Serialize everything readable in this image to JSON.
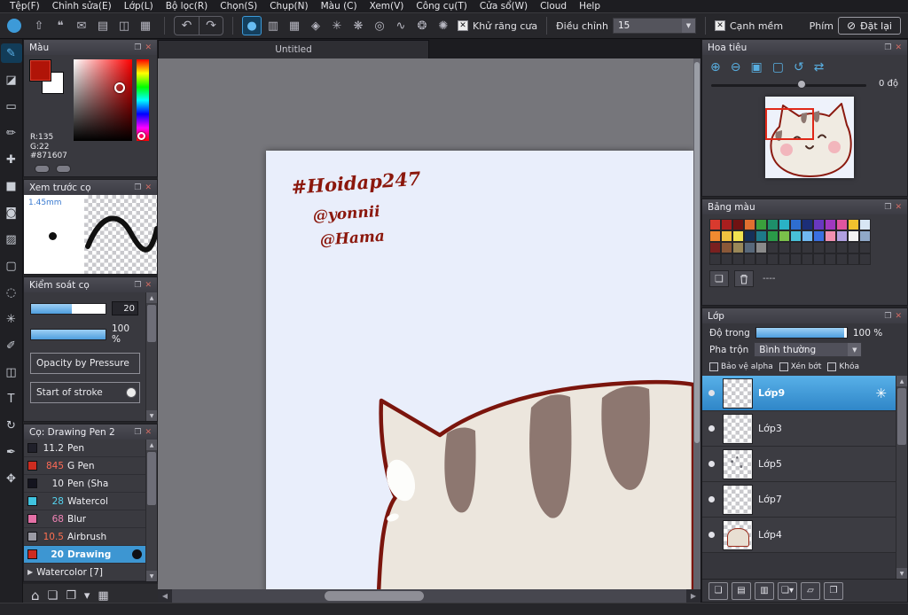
{
  "menubar": {
    "items": [
      "Tệp(F)",
      "Chỉnh sửa(E)",
      "Lớp(L)",
      "Bộ lọc(R)",
      "Chọn(S)",
      "Chụp(N)",
      "Màu (C)",
      "Xem(V)",
      "Công cụ(T)",
      "Cửa sổ(W)",
      "Cloud",
      "Help"
    ]
  },
  "toolbar": {
    "left_icons": [
      {
        "name": "export-icon",
        "glyph": "⇧"
      },
      {
        "name": "comment-icon",
        "glyph": "❝"
      },
      {
        "name": "message-icon",
        "glyph": "✉"
      },
      {
        "name": "document-icon",
        "glyph": "▤"
      },
      {
        "name": "layout-icon",
        "glyph": "◫"
      },
      {
        "name": "grid-icon",
        "glyph": "▦"
      }
    ],
    "undo_icon": "↶",
    "redo_icon": "↷",
    "option_icons": [
      {
        "name": "brush-circle-icon",
        "glyph": "●",
        "active": true
      },
      {
        "name": "brush-gradient-icon",
        "glyph": "▥"
      },
      {
        "name": "halftone-icon",
        "glyph": "▦"
      },
      {
        "name": "pattern-icon",
        "glyph": "◈"
      },
      {
        "name": "scatter-icon",
        "glyph": "✳"
      },
      {
        "name": "snowflake-icon",
        "glyph": "❋"
      },
      {
        "name": "target-icon",
        "glyph": "◎"
      },
      {
        "name": "correction-curve-icon",
        "glyph": "∿"
      },
      {
        "name": "gear-icon",
        "glyph": "❂"
      },
      {
        "name": "settings-icon",
        "glyph": "✺"
      }
    ],
    "antialias_label": "Khử răng cưa",
    "correction_label": "Điều chỉnh",
    "correction_value": "15",
    "soft_edge_label": "Cạnh mềm",
    "key_label": "Phím",
    "reset_button": "Đặt lại"
  },
  "left_tools": [
    {
      "name": "brush-tool",
      "glyph": "✎",
      "active": true
    },
    {
      "name": "eraser-tool",
      "glyph": "◪"
    },
    {
      "name": "rectangle-tool",
      "glyph": "▭"
    },
    {
      "name": "dot-pen-tool",
      "glyph": "✏"
    },
    {
      "name": "move-tool",
      "glyph": "✚"
    },
    {
      "name": "fill-rect-tool",
      "glyph": "■"
    },
    {
      "name": "bucket-tool",
      "glyph": "◙"
    },
    {
      "name": "gradient-tool",
      "glyph": "▨"
    },
    {
      "name": "select-rect-tool",
      "glyph": "▢"
    },
    {
      "name": "lasso-tool",
      "glyph": "◌"
    },
    {
      "name": "magic-wand-tool",
      "glyph": "✳"
    },
    {
      "name": "select-pen-tool",
      "glyph": "✐"
    },
    {
      "name": "select-eraser-tool",
      "glyph": "◫"
    },
    {
      "name": "text-tool",
      "glyph": "T"
    },
    {
      "name": "rotate-view-tool",
      "glyph": "↻"
    },
    {
      "name": "eyedropper-tool",
      "glyph": "✒"
    },
    {
      "name": "pan-tool",
      "glyph": "✥"
    }
  ],
  "left_footer_icons": [
    {
      "name": "home-icon",
      "glyph": "⌂"
    },
    {
      "name": "new-canvas-icon",
      "glyph": "❏"
    },
    {
      "name": "open-canvas-icon",
      "glyph": "❐"
    },
    {
      "name": "canvas-options-icon",
      "glyph": "▾"
    },
    {
      "name": "gallery-icon",
      "glyph": "▦"
    }
  ],
  "color_panel": {
    "title": "Màu",
    "r_value": "R:135",
    "g_value": "G:22",
    "hex_value": "#871607"
  },
  "brush_preview_panel": {
    "title": "Xem trước cọ",
    "size_label": "1.45mm"
  },
  "brush_control_panel": {
    "title": "Kiểm soát cọ",
    "width_value": "20",
    "opacity_value": "100 %",
    "row1_label": "Opacity by Pressure",
    "row2_label": "Start of stroke"
  },
  "brush_list_panel": {
    "title": "Cọ: Drawing Pen 2",
    "brushes": [
      {
        "size": "11.2",
        "name": "Pen",
        "swatch": "#20202a",
        "num_color": "#ececf0"
      },
      {
        "size": "845",
        "name": "G Pen",
        "swatch": "#cc2c20",
        "num_color": "#ff6a56"
      },
      {
        "size": "10",
        "name": "Pen (Sha",
        "swatch": "#14141e",
        "num_color": "#ececf0"
      },
      {
        "size": "28",
        "name": "Watercol",
        "swatch": "#40c4e0",
        "num_color": "#56d4f0"
      },
      {
        "size": "68",
        "name": "Blur",
        "swatch": "#e470a6",
        "num_color": "#f284b6"
      },
      {
        "size": "10.5",
        "name": "Airbrush",
        "swatch": "#9a9aa4",
        "num_color": "#ff7050"
      },
      {
        "size": "20",
        "name": "Drawing",
        "swatch": "#cc2c20",
        "num_color": "#ffffff",
        "selected": true
      }
    ],
    "folder_row": "Watercolor [7]"
  },
  "canvas": {
    "tab_title": "Untitled",
    "annotations": [
      "#Hoidap247",
      "@yonnii",
      "@Hama"
    ],
    "paper_color": "#e9eefb",
    "outline_color": "#7b150d",
    "fur_color": "#ece6dd",
    "stripe_color": "#8d7770",
    "ink_color": "#8b170c"
  },
  "navigator_panel": {
    "title": "Hoa tiêu",
    "angle_label": "0 độ",
    "icons": [
      {
        "name": "zoom-in-icon",
        "glyph": "⊕"
      },
      {
        "name": "zoom-out-icon",
        "glyph": "⊖"
      },
      {
        "name": "fit-window-icon",
        "glyph": "▣"
      },
      {
        "name": "actual-size-icon",
        "glyph": "▢"
      },
      {
        "name": "reset-rotation-icon",
        "glyph": "↺"
      },
      {
        "name": "flip-view-icon",
        "glyph": "⇄"
      }
    ]
  },
  "palette_panel": {
    "title": "Bảng màu",
    "empty_label": "----",
    "rows": [
      [
        "#d93a2e",
        "#a81e1e",
        "#701212",
        "#e07030",
        "#3aa03c",
        "#1e8f6a",
        "#2ab2c6",
        "#2e6ed0",
        "#1c2e78",
        "#6838c0",
        "#a038c0",
        "#e055a0",
        "#f0c22e",
        "#d8e6f4"
      ],
      [
        "#f08a30",
        "#f0c240",
        "#f0e250",
        "#163058",
        "#1e7a8a",
        "#2a9a48",
        "#7ac04a",
        "#48c0d8",
        "#70b8f0",
        "#3a70e0",
        "#f090b0",
        "#b0a0e0",
        "#f2f2f2",
        "#90a8c8"
      ],
      [
        "#7a2020",
        "#8a5838",
        "#9a8858",
        "#58687a",
        "#8a8a8a",
        null,
        null,
        null,
        null,
        null,
        null,
        null,
        null,
        null
      ],
      [
        null,
        null,
        null,
        null,
        null,
        null,
        null,
        null,
        null,
        null,
        null,
        null,
        null,
        null
      ]
    ]
  },
  "layer_panel": {
    "title": "Lớp",
    "opacity_label": "Độ trong",
    "opacity_value": "100 %",
    "blend_label": "Pha trộn",
    "blend_value": "Bình thường",
    "checkbox_labels": [
      "Bảo vệ alpha",
      "Xén bớt",
      "Khóa"
    ],
    "layers": [
      {
        "name": "Lớp9",
        "selected": true,
        "thumb": "plain"
      },
      {
        "name": "Lớp3",
        "thumb": "plain"
      },
      {
        "name": "Lớp5",
        "thumb": "sketch"
      },
      {
        "name": "Lớp7",
        "thumb": "plain"
      },
      {
        "name": "Lớp4",
        "thumb": "cat"
      }
    ],
    "tool_icons": [
      {
        "name": "new-layer-icon",
        "glyph": "❏"
      },
      {
        "name": "new-8bit-layer-icon",
        "glyph": "▤"
      },
      {
        "name": "new-1bit-layer-icon",
        "glyph": "▥"
      },
      {
        "name": "add-layer-menu-icon",
        "glyph": "❏▾"
      },
      {
        "name": "new-folder-icon",
        "glyph": "▱"
      },
      {
        "name": "duplicate-layer-icon",
        "glyph": "❐"
      }
    ]
  }
}
